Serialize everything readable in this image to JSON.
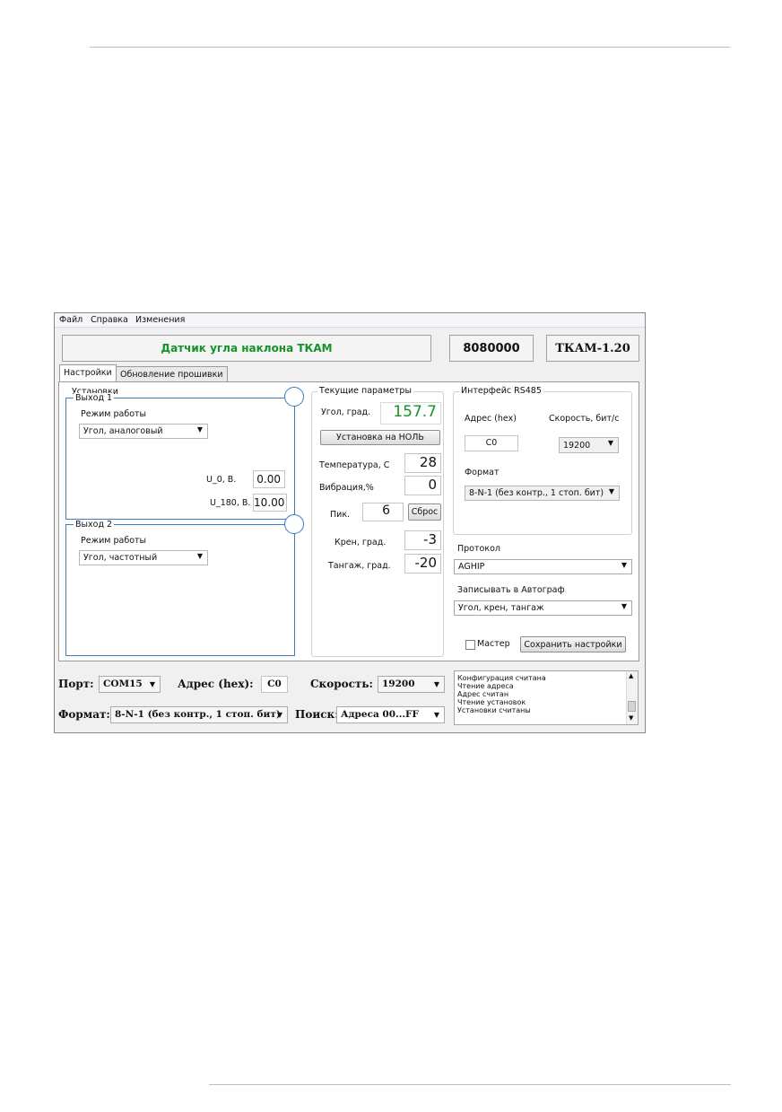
{
  "menu": [
    "Файл",
    "Справка",
    "Изменения"
  ],
  "header": {
    "title": "Датчик угла наклона ТКАМ",
    "serial": "8080000",
    "model": "ТКАМ-1.20"
  },
  "tabs": [
    "Настройки",
    "Обновление прошивки"
  ],
  "settings": {
    "group_title": "Установки",
    "output1": {
      "title": "Выход 1",
      "mode_label": "Режим работы",
      "mode_value": "Угол, аналоговый",
      "u0_label": "U_0, В.",
      "u0_value": "0.00",
      "u180_label": "U_180, В.",
      "u180_value": "10.00"
    },
    "output2": {
      "title": "Выход 2",
      "mode_label": "Режим работы",
      "mode_value": "Угол, частотный"
    }
  },
  "current": {
    "group_title": "Текущие параметры",
    "angle_label": "Угол, град.",
    "angle_value": "157.7",
    "zero_button": "Установка на НОЛЬ",
    "temp_label": "Температура, С",
    "temp_value": "28",
    "vibration_label": "Вибрация,%",
    "vibration_value": "0",
    "peak_label": "Пик.",
    "peak_value": "6",
    "reset_button": "Сброс",
    "roll_label": "Крен, град.",
    "roll_value": "-3",
    "pitch_label": "Тангаж, град.",
    "pitch_value": "-20"
  },
  "rs485": {
    "group_title": "Интерфейс RS485",
    "address_label": "Адрес (hex)",
    "address_value": "C0",
    "speed_label": "Скорость, бит/с",
    "speed_value": "19200",
    "format_label": "Формат",
    "format_value": "8-N-1 (без контр., 1 стоп. бит)"
  },
  "protocol": {
    "label": "Протокол",
    "value": "AGHIP"
  },
  "autograph": {
    "label": "Записывать в Автограф",
    "value": "Угол, крен, тангаж"
  },
  "master_label": "Мастер",
  "save_button": "Сохранить настройки",
  "bottom": {
    "port_label": "Порт:",
    "port_value": "COM15",
    "address_label": "Адрес (hex):",
    "address_value": "C0",
    "speed_label": "Скорость:",
    "speed_value": "19200",
    "format_label": "Формат:",
    "format_value": "8-N-1 (без контр., 1 стоп. бит)",
    "search_label": "Поиск:",
    "search_value": "Адреса 00...FF"
  },
  "log": [
    "Конфигурация считана",
    "Чтение адреса",
    "Адрес считан",
    "Чтение установок",
    "Установки считаны"
  ],
  "colors": {
    "title_green": "#17922b",
    "output_border": "#3c7cc0"
  }
}
